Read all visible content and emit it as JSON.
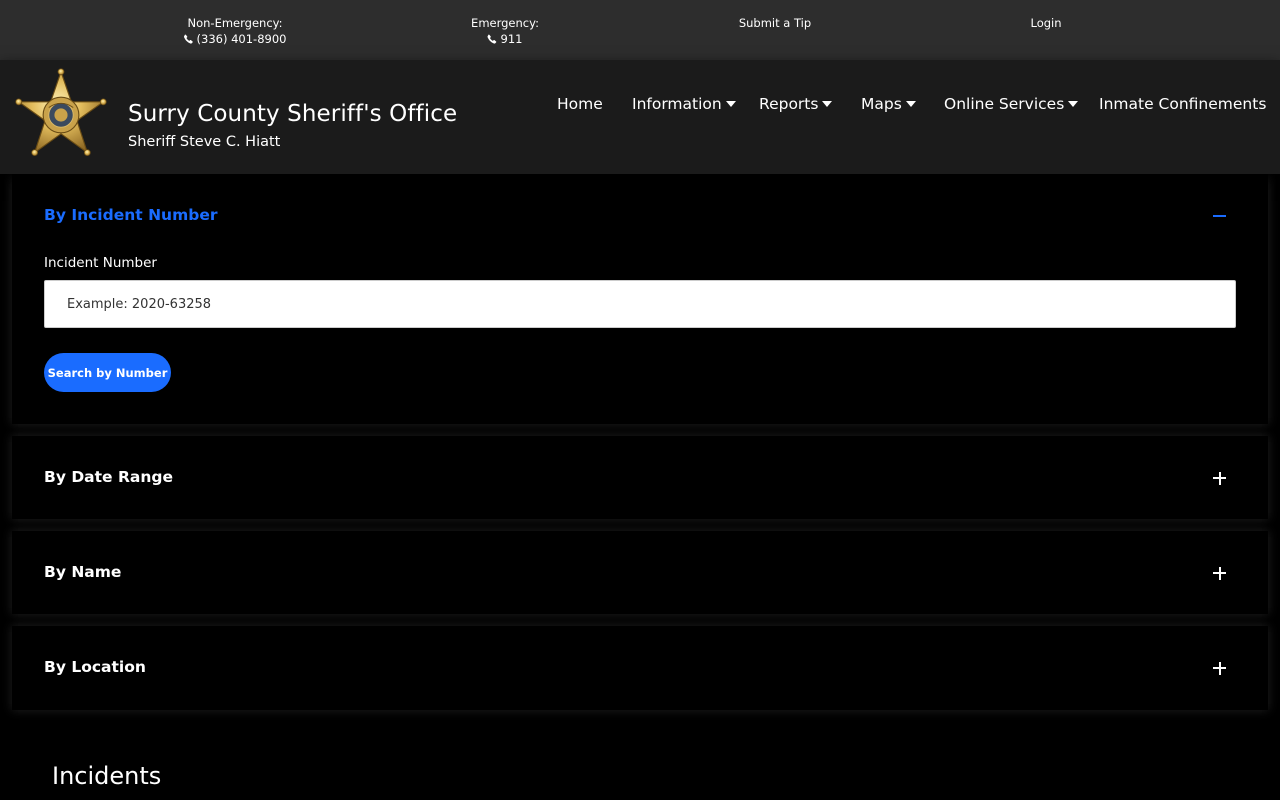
{
  "topbar": {
    "non_emergency_label": "Non-Emergency:",
    "non_emergency_phone": "(336) 401-8900",
    "emergency_label": "Emergency:",
    "emergency_phone": "911",
    "submit_tip": "Submit a Tip",
    "login": "Login",
    "phone_icon": "phone-icon"
  },
  "header": {
    "badge_icon": "sheriff-star-badge",
    "title": "Surry County Sheriff's Office",
    "subtitle": "Sheriff Steve C. Hiatt",
    "nav": [
      {
        "label": "Home",
        "dropdown": false
      },
      {
        "label": "Information",
        "dropdown": true
      },
      {
        "label": "Reports",
        "dropdown": true
      },
      {
        "label": "Maps",
        "dropdown": true
      },
      {
        "label": "Online Services",
        "dropdown": true
      },
      {
        "label": "Inmate Confinements",
        "dropdown": false
      }
    ]
  },
  "accordion": {
    "by_number": {
      "title": "By Incident Number",
      "expanded": true,
      "field_label": "Incident Number",
      "input_placeholder": "Example: 2020-63258",
      "button_label": "Search by Number"
    },
    "by_date": {
      "title": "By Date Range",
      "expanded": false
    },
    "by_name": {
      "title": "By Name",
      "expanded": false
    },
    "by_location": {
      "title": "By Location",
      "expanded": false
    }
  },
  "incidents": {
    "heading": "Incidents"
  },
  "colors": {
    "accent": "#1a6cff",
    "topbar_bg": "#2d2d2d",
    "header_bg": "#1b1b1b",
    "page_bg": "#000000"
  }
}
